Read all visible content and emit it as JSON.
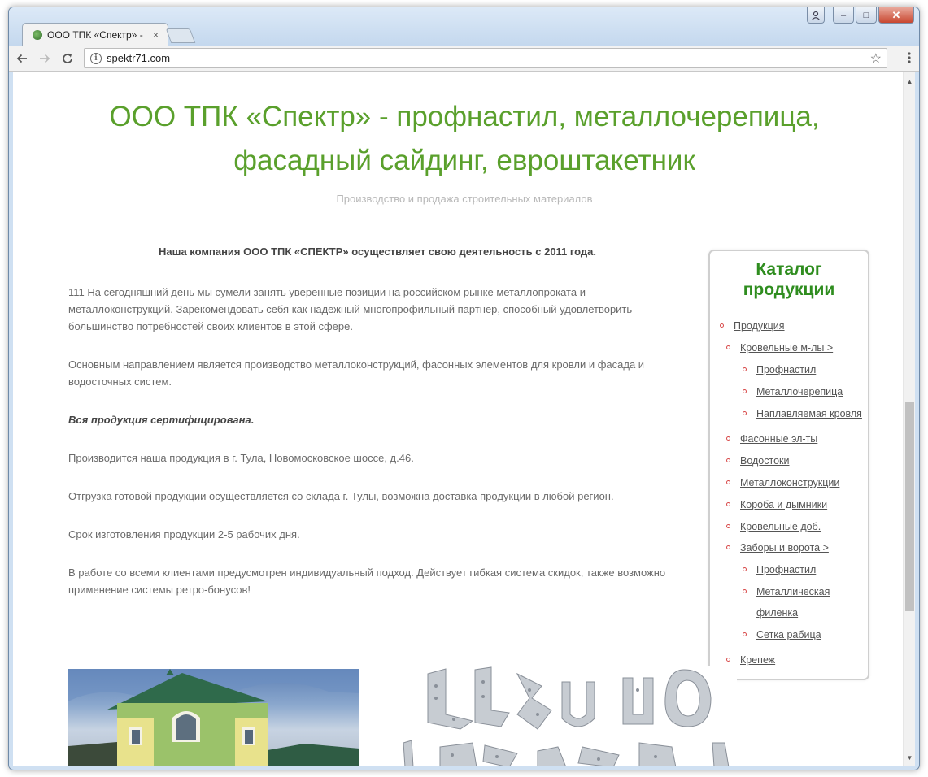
{
  "browser": {
    "tab_title": "ООО ТПК «Спектр» - пр",
    "tab_close": "×",
    "url": "spektr71.com",
    "controls": {
      "minimize": "–",
      "maximize": "□",
      "close": "✕"
    }
  },
  "site": {
    "title": "ООО ТПК «Спектр» - профнастил, металлочерепица, фасадный сайдинг, евроштакетник",
    "tagline": "Производство и продажа строительных материалов"
  },
  "content": {
    "intro": "Наша компания ООО ТПК «СПЕКТР» осуществляет свою деятельность с 2011 года.",
    "p1": "111 На сегодняшний день мы сумели занять уверенные позиции на российском рынке металлопроката и металлоконструкций. Зарекомендовать себя как надежный многопрофильный партнер, способный удовлетворить большинство потребностей своих клиентов в этой сфере.",
    "p2": "Основным направлением является производство металлоконструкций, фасонных элементов для кровли и фасада и водосточных систем.",
    "p3": "Вся продукция сертифицирована.",
    "p4": "Производится наша продукция в г. Тула, Новомосковское шоссе, д.46.",
    "p5": "Отгрузка готовой продукции осуществляется со склада г. Тулы, возможна доставка продукции в любой регион.",
    "p6": "Срок изготовления продукции 2-5 рабочих дня.",
    "p7": "В работе со всеми клиентами предусмотрен индивидуальный подход. Действует гибкая система скидок, также возможно применение системы ретро-бонусов!"
  },
  "catalog": {
    "heading": "Каталог продукции",
    "items": [
      {
        "label": "Продукция"
      },
      {
        "label": "Кровельные м-лы >"
      },
      {
        "label": "Профнастил"
      },
      {
        "label": "Металлочерепица"
      },
      {
        "label": "Наплавляемая кровля"
      },
      {
        "label": "Фасонные эл-ты"
      },
      {
        "label": "Водостоки"
      },
      {
        "label": "Металлоконструкции"
      },
      {
        "label": "Короба и дымники"
      },
      {
        "label": "Кровельные доб."
      },
      {
        "label": "Заборы и ворота >"
      },
      {
        "label": "Профнастил"
      },
      {
        "label": "Металлическая"
      },
      {
        "label": "филенка"
      },
      {
        "label": "Сетка рабица"
      },
      {
        "label": "Крепеж"
      }
    ]
  },
  "colors": {
    "title_green": "#5aa02c",
    "catalog_green": "#2f8d1f",
    "bullet_red": "#d84a4a"
  }
}
